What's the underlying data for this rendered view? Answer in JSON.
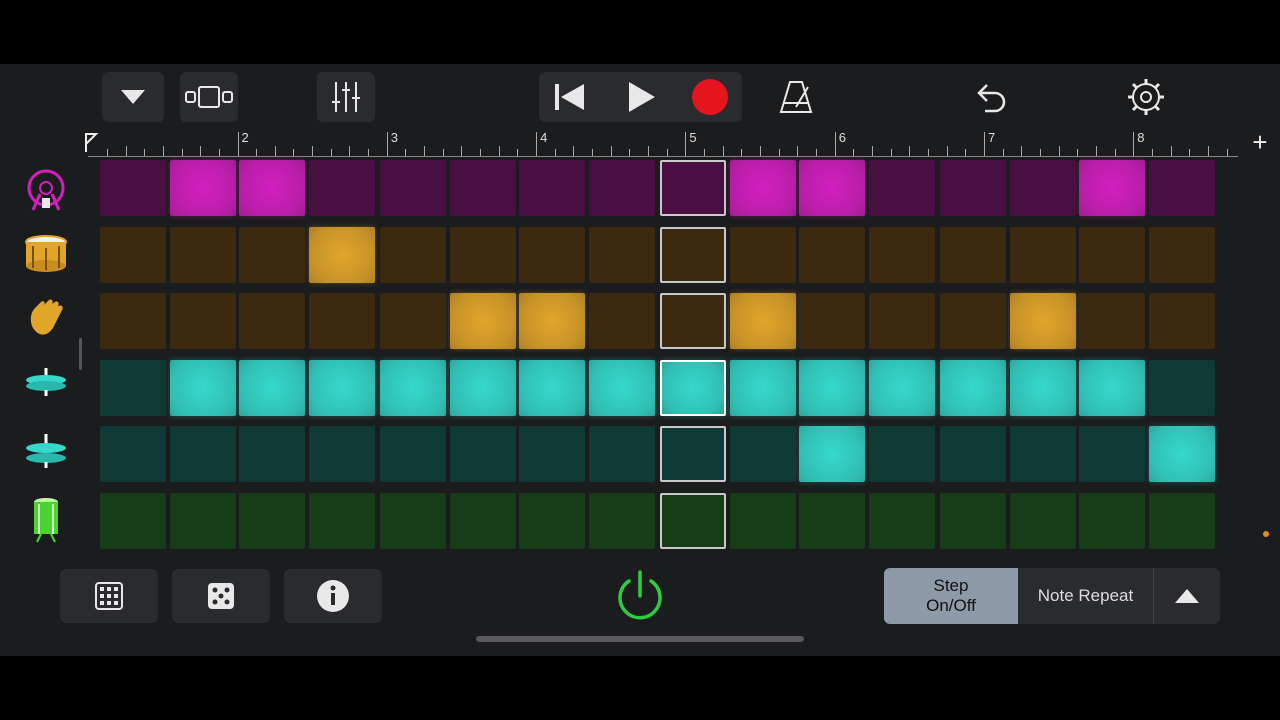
{
  "toolbar": {
    "icons": [
      "dropdown-triangle-icon",
      "tracks-view-icon",
      "mixer-sliders-icon",
      "rewind-icon",
      "play-icon",
      "record-icon",
      "metronome-icon",
      "undo-icon",
      "settings-gear-icon"
    ]
  },
  "ruler": {
    "bars": [
      "2",
      "3",
      "4",
      "5",
      "6",
      "7",
      "8"
    ],
    "add_label": "+"
  },
  "sequencer": {
    "steps_per_row": 16,
    "current_step": 9,
    "rows": [
      {
        "instrument": "kick-drum-icon",
        "color": "#d21fbe",
        "dim": "#4a0f42",
        "active": [
          2,
          3,
          10,
          11,
          15
        ]
      },
      {
        "instrument": "snare-drum-icon",
        "color": "#e1a52a",
        "dim": "#3b2a0f",
        "active": [
          4
        ]
      },
      {
        "instrument": "hand-clap-icon",
        "color": "#e1a52a",
        "dim": "#3b2a0f",
        "active": [
          6,
          7,
          10,
          14
        ]
      },
      {
        "instrument": "closed-hihat-icon",
        "color": "#35d9cc",
        "dim": "#0f3a36",
        "active": [
          2,
          3,
          4,
          5,
          6,
          7,
          8,
          9,
          10,
          11,
          12,
          13,
          14,
          15
        ]
      },
      {
        "instrument": "open-hihat-icon",
        "color": "#35d9cc",
        "dim": "#0f3a36",
        "active": [
          11,
          16
        ]
      },
      {
        "instrument": "tom-drum-icon",
        "color": "#4bd42f",
        "dim": "#173d17",
        "active": []
      }
    ]
  },
  "bottom": {
    "step_toggle_line1": "Step",
    "step_toggle_line2": "On/Off",
    "note_repeat": "Note Repeat",
    "icons": [
      "grid-keypad-icon",
      "dice-icon",
      "info-icon",
      "power-icon",
      "expand-up-icon"
    ]
  },
  "colors": {
    "accent_green": "#2ecc40",
    "record_red": "#e4151c",
    "selected_toggle": "#8e9aa8"
  }
}
